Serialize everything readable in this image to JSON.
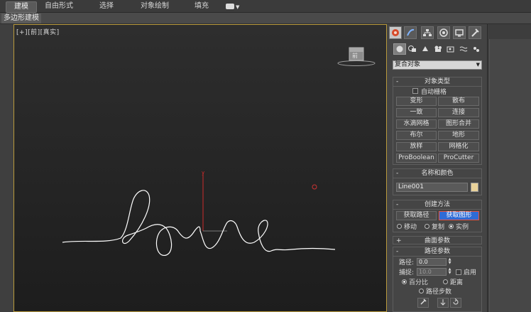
{
  "ribbon": {
    "tabs": [
      {
        "label": "建模",
        "active": true
      },
      {
        "label": "自由形式",
        "active": false
      },
      {
        "label": "选择",
        "active": false
      },
      {
        "label": "对象绘制",
        "active": false
      },
      {
        "label": "填充",
        "active": false
      }
    ]
  },
  "subbar": {
    "label": "多边形建模"
  },
  "viewport": {
    "label": "[+][前][真实]",
    "viewcube_icon": "viewcube-icon",
    "shape_description": "love line spline",
    "colors": {
      "border": "#b99a3c",
      "spline": "#ffffff",
      "axis": "#cc2b2b"
    }
  },
  "panel": {
    "tab_icons": [
      "create-tab-icon",
      "modify-tab-icon",
      "hierarchy-tab-icon",
      "motion-tab-icon",
      "display-tab-icon",
      "utilities-tab-icon"
    ],
    "category_icons": [
      "geometry-icon",
      "shapes-icon",
      "lights-icon",
      "cameras-icon",
      "helpers-icon",
      "spacewarps-icon",
      "systems-icon"
    ],
    "dropdown": {
      "value": "复合对象"
    },
    "object_type": {
      "title": "对象类型",
      "auto_grid": "自动栅格",
      "buttons": [
        "变形",
        "散布",
        "一致",
        "连接",
        "水滴网格",
        "图形合并",
        "布尔",
        "地形",
        "放样",
        "网格化",
        "ProBoolean",
        "ProCutter"
      ]
    },
    "name_color": {
      "title": "名称和颜色",
      "name_value": "Line001",
      "swatch_color": "#e9d29a"
    },
    "creation_method": {
      "title": "创建方法",
      "get_path": "获取路径",
      "get_shape": "获取图形",
      "options": [
        "移动",
        "复制",
        "实例"
      ],
      "selected_option": "实例"
    },
    "surface_params": {
      "title": "曲面参数"
    },
    "path_params": {
      "title": "路径参数",
      "path_label": "路径:",
      "path_value": "0.0",
      "snap_label": "捕捉:",
      "snap_value": "10.0",
      "enable_label": "启用",
      "percent_label": "百分比",
      "distance_label": "距离",
      "path_steps_label": "路径步数"
    }
  }
}
